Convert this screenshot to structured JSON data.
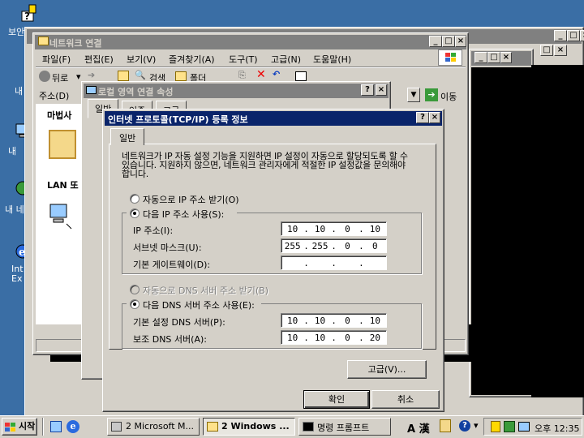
{
  "desktop": {
    "icons": [
      {
        "label": "보안",
        "name": "desktop-icon-security"
      },
      {
        "label": "내",
        "name": "desktop-icon-mydocs"
      },
      {
        "label": "내",
        "name": "desktop-icon-mycomputer"
      },
      {
        "label": "내 네",
        "name": "desktop-icon-network"
      },
      {
        "label": "Int Ex",
        "name": "desktop-icon-ie"
      }
    ]
  },
  "back_window": {
    "title": "",
    "controls": [
      "_",
      "□",
      "×"
    ]
  },
  "cmd_window": {
    "controls": [
      "_",
      "□",
      "×"
    ]
  },
  "netconn": {
    "title": "네트워크 연결",
    "menu": [
      "파일(F)",
      "편집(E)",
      "보기(V)",
      "즐겨찾기(A)",
      "도구(T)",
      "고급(N)",
      "도움말(H)"
    ],
    "toolbar": {
      "back": "뒤로",
      "search": "검색",
      "folders": "폴더"
    },
    "address_label": "주소(D)",
    "go_label": "이동",
    "left_wizard": "마법사",
    "left_lan": "LAN 또"
  },
  "lanprops": {
    "title": "로컬 영역 연결 속성",
    "tabs": [
      "일반",
      "인증",
      "고급"
    ]
  },
  "tcpip": {
    "title": "인터넷 프로토콜(TCP/IP) 등록 정보",
    "tab": "일반",
    "description": "네트워크가 IP 자동 설정 기능을 지원하면 IP 설정이 자동으로 할당되도록 할 수 있습니다. 지원하지 않으면, 네트워크 관리자에게 적절한 IP 설정값을 문의해야 합니다.",
    "auto_ip_label": "자동으로 IP 주소 받기(O)",
    "manual_ip_label": "다음 IP 주소 사용(S):",
    "ip_label": "IP 주소(I):",
    "ip_value": [
      "10",
      "10",
      "0",
      "10"
    ],
    "subnet_label": "서브넷 마스크(U):",
    "subnet_value": [
      "255",
      "255",
      "0",
      "0"
    ],
    "gateway_label": "기본 게이트웨이(D):",
    "gateway_value": [
      "",
      "",
      "",
      ""
    ],
    "auto_dns_label": "자동으로 DNS 서버 주소 받기(B)",
    "manual_dns_label": "다음 DNS 서버 주소 사용(E):",
    "dns1_label": "기본 설정 DNS 서버(P):",
    "dns1_value": [
      "10",
      "10",
      "0",
      "10"
    ],
    "dns2_label": "보조 DNS 서버(A):",
    "dns2_value": [
      "10",
      "10",
      "0",
      "20"
    ],
    "advanced_button": "고급(V)...",
    "ok_button": "확인",
    "cancel_button": "취소"
  },
  "taskbar": {
    "start": "시작",
    "tasks": [
      "2 Microsoft M...",
      "2 Windows ...",
      "명령 프롬프트"
    ],
    "lang": "A 漢",
    "clock": "오후 12:35"
  }
}
